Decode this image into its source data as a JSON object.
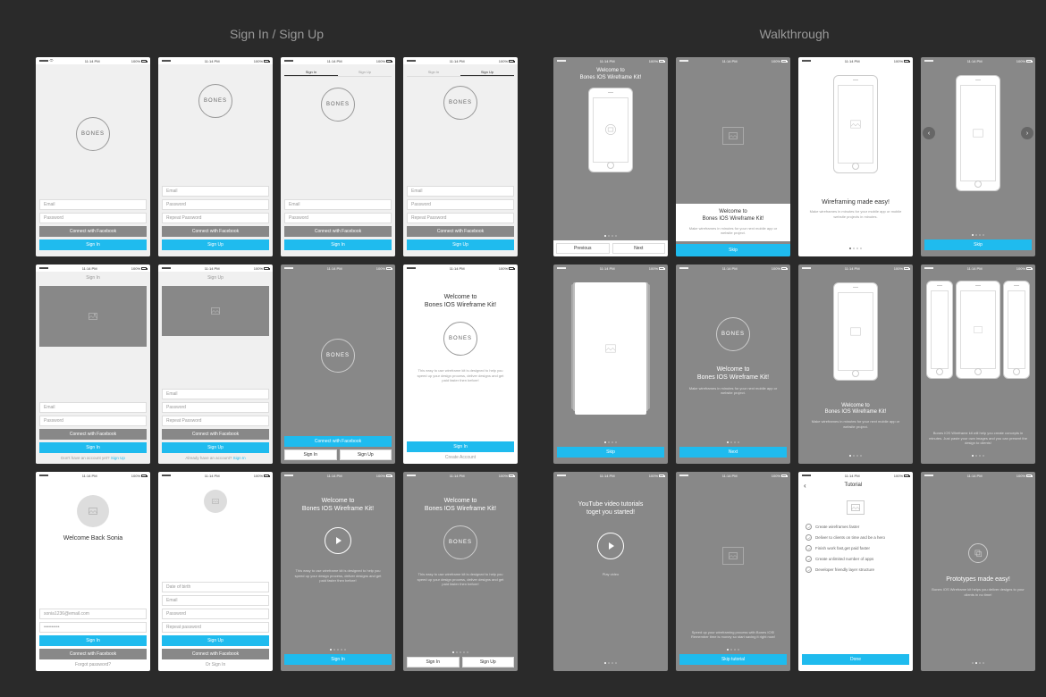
{
  "sections": {
    "signin": {
      "title": "Sign In / Sign Up"
    },
    "walkthrough": {
      "title": "Walkthrough"
    }
  },
  "status": {
    "time": "11:14 PM",
    "pct": "100%"
  },
  "brand": "BONES",
  "labels": {
    "email": "Email",
    "password": "Password",
    "repeat_password": "Repeat Password",
    "connect_fb": "Connect with Facebook",
    "sign_in": "Sign In",
    "sign_up": "Sign Up",
    "create_account": "Create Account",
    "forgot": "Forgot password?",
    "or_sign_in": "Or Sign In",
    "date_of_birth": "Date of birth",
    "repeat_password_lc": "Repeat password",
    "previous": "Previous",
    "next": "Next",
    "skip": "Skip",
    "done": "Done",
    "skip_tutorial": "Skip tutorial",
    "play_video": "Play video",
    "tutorial": "Tutorial"
  },
  "text": {
    "welcome_kit": "Welcome to\nBones IOS Wireframe Kit!",
    "welcome_back": "Welcome Back Sonia",
    "wireframing_easy": "Wireframing made easy!",
    "prototypes_easy": "Prototypes made easy!",
    "youtube_tutorials": "YouTube video tutorials\ntoget you started!",
    "kit_description": "This easy to use wireframe kit is designed to help you speed up your design process, deliver designs and get paid faster then before!",
    "make_wireframes": "Make wireframes in minutes for your mobile app or mobile website projects in minutes.",
    "make_wireframes2": "Make wireframes in minutes for your next mobile app or website project.",
    "speed_up": "Speed up your wireframing process with Bones IOS! Remember time is money so start saving it right now!",
    "deliver_designs": "Bones IOS Wireframe kit helps you deliver designs to your clients in no time!",
    "create_concepts": "Bones IOS Wireframe kit will help you create concepts in minutes. Just paste your own images and you can present the design to clients!",
    "dont_have_account": "Don't have an account yet? ",
    "already_have": "Already have an account? ",
    "sample_email": "sonia1236@email.com",
    "sample_pwd": "••••••••••"
  },
  "checklist": [
    "Create wireframes faster",
    "Deliver to clients on time and be a hero",
    "Finish work fast,get paid faster",
    "Create unlimited number of apps",
    "Developer friendly layer structure"
  ]
}
